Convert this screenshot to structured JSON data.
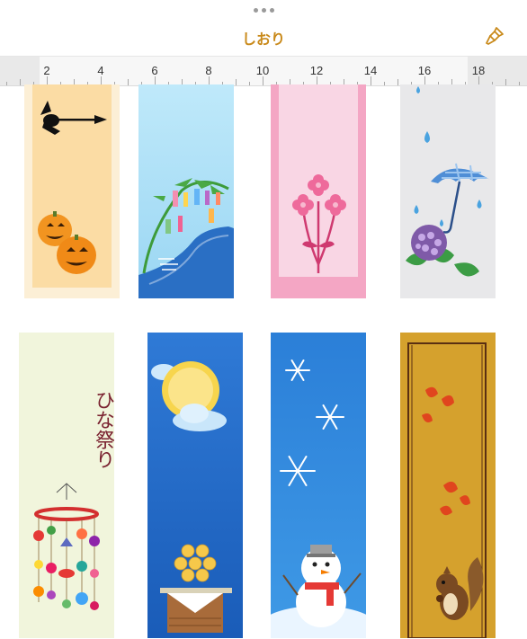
{
  "header": {
    "title": "しおり",
    "more_icon": "ellipsis-icon",
    "paint_icon": "paintbrush-icon",
    "accent": "#c98a1b"
  },
  "ruler": {
    "labels": [
      "2",
      "4",
      "6",
      "8",
      "10",
      "12",
      "14",
      "16",
      "18"
    ]
  },
  "bookmarks": [
    {
      "theme": "halloween"
    },
    {
      "theme": "tanabata"
    },
    {
      "theme": "flower"
    },
    {
      "theme": "rainy-season"
    },
    {
      "theme": "hinamatsuri",
      "text": "ひな祭り"
    },
    {
      "theme": "moon-viewing"
    },
    {
      "theme": "winter-snowman"
    },
    {
      "theme": "autumn-squirrel"
    }
  ]
}
